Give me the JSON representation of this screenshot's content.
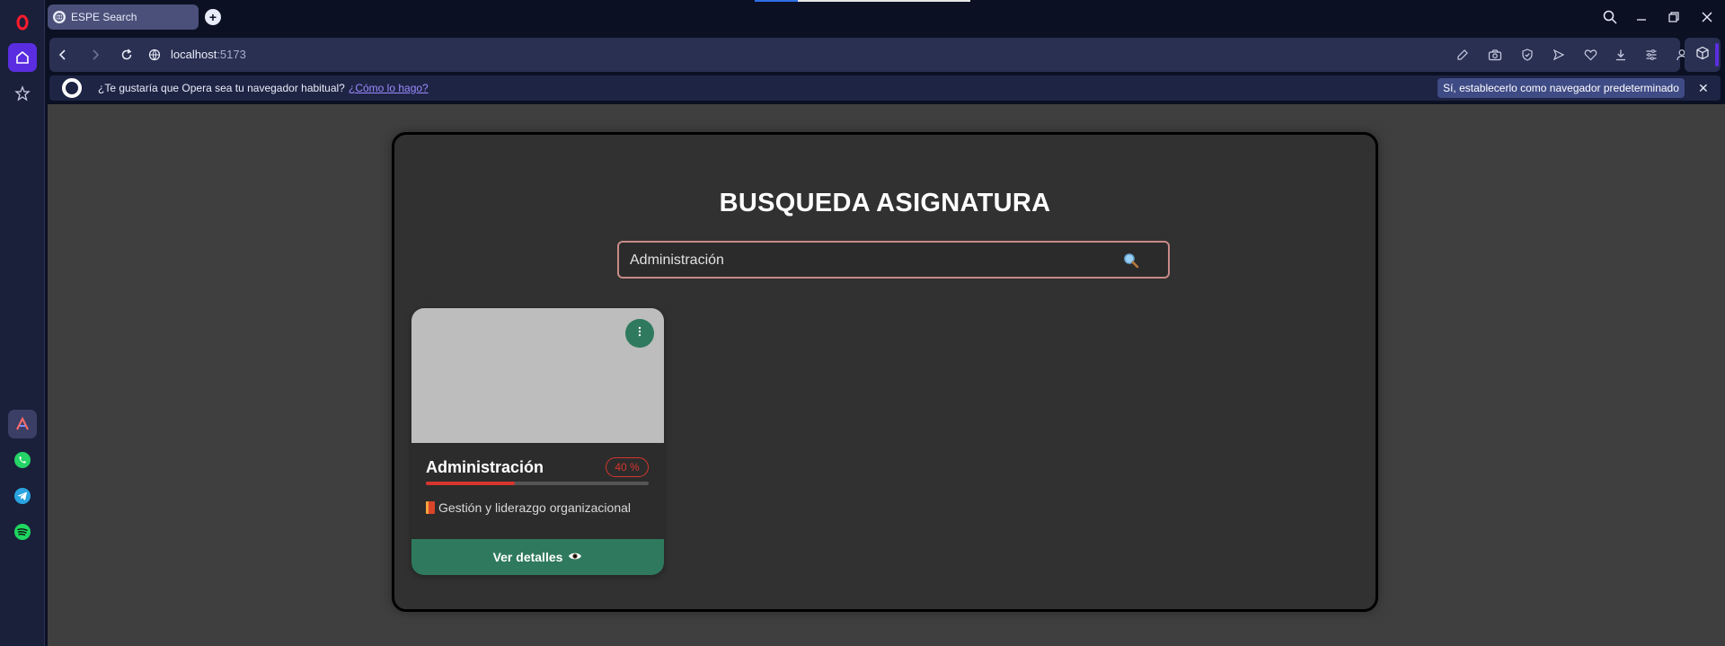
{
  "browser": {
    "tab_title": "ESPE Search",
    "url_host": "localhost",
    "url_port": ":5173"
  },
  "infobar": {
    "message": "¿Te gustaría que Opera sea tu navegador habitual?",
    "link": "¿Cómo lo hago?",
    "button": "Sí, establecerlo como navegador predeterminado"
  },
  "page": {
    "title": "BUSQUEDA ASIGNATURA",
    "search_value": "Administración"
  },
  "card": {
    "title": "Administración",
    "progress_label": "40 %",
    "progress": 0.4,
    "description": "Gestión y liderazgo organizacional",
    "button": "Ver detalles"
  },
  "colors": {
    "accent_green": "#2f7a5e",
    "progress_red": "#d6362f",
    "opera_purple": "#5a2ee0"
  }
}
